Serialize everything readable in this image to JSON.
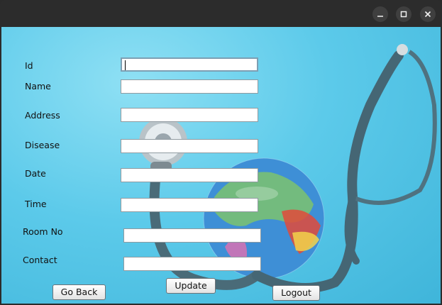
{
  "window": {
    "controls": {
      "minimize_icon": "minimize-icon",
      "maximize_icon": "maximize-icon",
      "close_icon": "close-icon"
    }
  },
  "form": {
    "fields": {
      "id": {
        "label": "Id",
        "value": ""
      },
      "name": {
        "label": "Name",
        "value": ""
      },
      "address": {
        "label": "Address",
        "value": ""
      },
      "disease": {
        "label": "Disease",
        "value": ""
      },
      "date": {
        "label": "Date",
        "value": ""
      },
      "time": {
        "label": "Time",
        "value": ""
      },
      "room_no": {
        "label": "Room No",
        "value": ""
      },
      "contact": {
        "label": "Contact",
        "value": ""
      }
    }
  },
  "buttons": {
    "go_back": "Go Back",
    "update": "Update",
    "logout": "Logout"
  },
  "colors": {
    "background": "#5ccaea",
    "titlebar": "#2c2c2c"
  }
}
